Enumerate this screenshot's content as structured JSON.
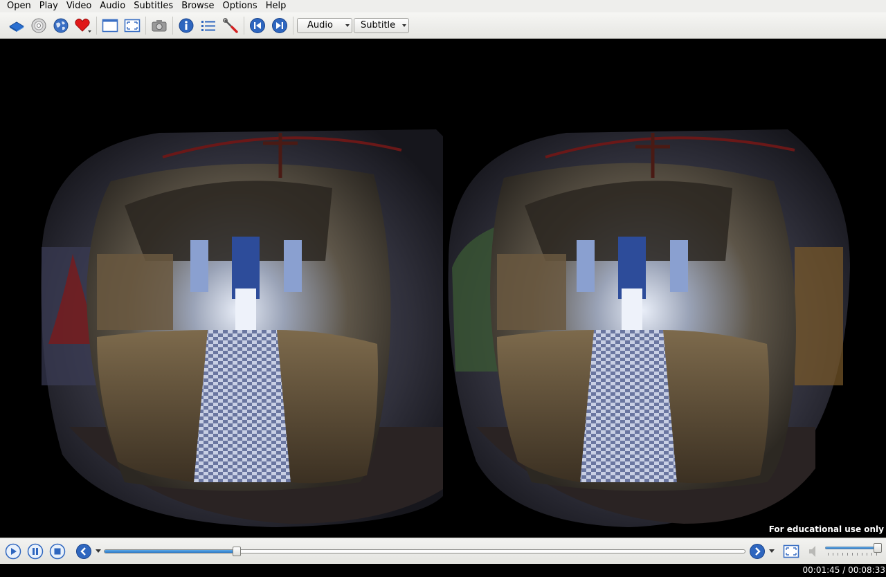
{
  "menubar": {
    "items": [
      "Open",
      "Play",
      "Video",
      "Audio",
      "Subtitles",
      "Browse",
      "Options",
      "Help"
    ]
  },
  "toolbar": {
    "icons": [
      "open-file-icon",
      "disc-icon",
      "network-icon",
      "favorites-icon",
      "window-icon",
      "fullscreen-icon",
      "screenshot-icon",
      "info-icon",
      "playlist-icon",
      "preferences-icon",
      "previous-icon",
      "next-icon"
    ],
    "audio_label": "Audio",
    "subtitle_label": "Subtitle"
  },
  "video": {
    "watermark": "For educational use only"
  },
  "controls": {
    "seek_progress": 0.207,
    "volume_level": 1.0,
    "accent_color": "#2b78c6"
  },
  "status": {
    "time": "00:01:45 / 00:08:33"
  }
}
